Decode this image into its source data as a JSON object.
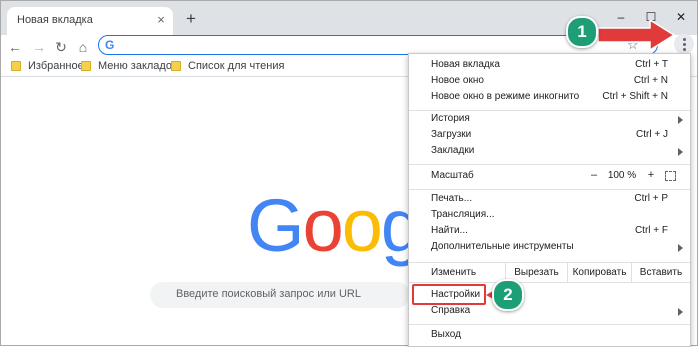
{
  "browser": {
    "tab_title": "Новая вкладка",
    "tab_close": "×",
    "new_tab": "+",
    "window": {
      "minimize": "–",
      "maximize": "☐",
      "close": "✕"
    },
    "nav": {
      "back": "←",
      "forward": "→",
      "reload": "↻",
      "home": "⌂"
    },
    "omnibox_icon": "G",
    "star": "☆"
  },
  "bookmarks": [
    {
      "label": "Избранное",
      "icon": "folder-icon"
    },
    {
      "label": "Меню закладок",
      "icon": "folder-icon"
    },
    {
      "label": "Список для чтения",
      "icon": "folder-icon"
    }
  ],
  "page": {
    "logo_letters": [
      "G",
      "o",
      "o",
      "g",
      "l",
      "e"
    ],
    "logo_colors": [
      "#4285f4",
      "#ea4335",
      "#fbbc05",
      "#4285f4",
      "#34a853",
      "#ea4335"
    ],
    "search_placeholder": "Введите поисковый запрос или URL"
  },
  "menu": {
    "new_tab": {
      "label": "Новая вкладка",
      "shortcut": "Ctrl + T"
    },
    "new_window": {
      "label": "Новое окно",
      "shortcut": "Ctrl + N"
    },
    "incognito": {
      "label": "Новое окно в режиме инкогнито",
      "shortcut": "Ctrl + Shift + N"
    },
    "history": {
      "label": "История"
    },
    "downloads": {
      "label": "Загрузки",
      "shortcut": "Ctrl + J"
    },
    "bookmarks": {
      "label": "Закладки"
    },
    "zoom": {
      "label": "Масштаб",
      "minus": "–",
      "value": "100 %",
      "plus": "+"
    },
    "print": {
      "label": "Печать...",
      "shortcut": "Ctrl + P"
    },
    "cast": {
      "label": "Трансляция..."
    },
    "find": {
      "label": "Найти...",
      "shortcut": "Ctrl + F"
    },
    "more_tools": {
      "label": "Дополнительные инструменты"
    },
    "edit": {
      "label": "Изменить",
      "cut": "Вырезать",
      "copy": "Копировать",
      "paste": "Вставить"
    },
    "settings": {
      "label": "Настройки"
    },
    "help": {
      "label": "Справка"
    },
    "exit": {
      "label": "Выход"
    }
  },
  "callouts": {
    "first": "1",
    "second": "2"
  },
  "colors": {
    "callout": "#1e9e76",
    "arrow": "#e03a3a",
    "accent": "#1a73e8"
  }
}
